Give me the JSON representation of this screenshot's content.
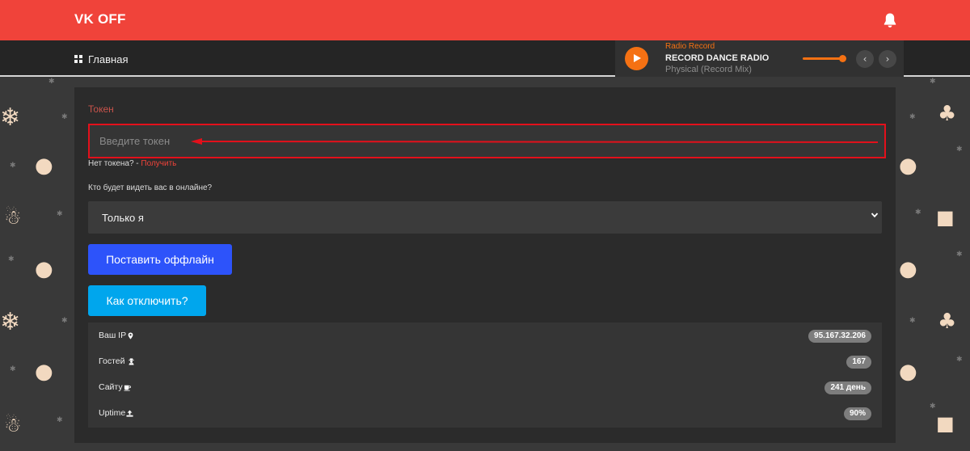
{
  "header": {
    "brand": "VK OFF",
    "bell_icon": "bell-icon"
  },
  "nav": {
    "home_label": "Главная",
    "home_icon": "grid-icon"
  },
  "player": {
    "station": "Radio Record",
    "title": "RECORD DANCE RADIO",
    "track": "Physical (Record Mix)",
    "prev_icon": "‹",
    "next_icon": "›",
    "accent_color": "#f57113"
  },
  "form": {
    "token_label": "Токен",
    "token_placeholder": "Введите токен",
    "token_value": "",
    "no_token_text": "Нет токена? - ",
    "get_link": "Получить",
    "who_label": "Кто будет видеть вас в онлайне?",
    "visibility_selected": "Только я",
    "offline_button": "Поставить оффлайн",
    "howto_button": "Как отключить?"
  },
  "stats": [
    {
      "label": "Ваш IP",
      "icon": "map-marker-icon",
      "value": "95.167.32.206"
    },
    {
      "label": "Гостей",
      "icon": "user-secret-icon",
      "value": "167"
    },
    {
      "label": "Сайту",
      "icon": "coffee-icon",
      "value": "241 день"
    },
    {
      "label": "Uptime",
      "icon": "upload-icon",
      "value": "90%"
    }
  ],
  "colors": {
    "brand_red": "#f0433a",
    "primary_blue": "#2d53fa",
    "info_blue": "#00a6ed",
    "highlight_red": "#e3101b"
  }
}
